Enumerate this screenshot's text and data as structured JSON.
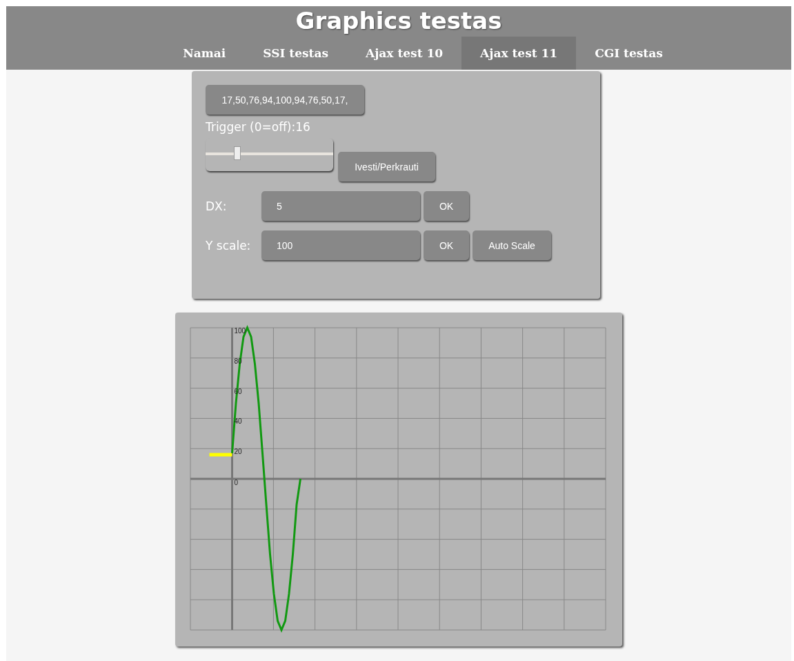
{
  "header": {
    "title": "Graphics testas"
  },
  "nav": [
    {
      "label": "Namai",
      "selected": false
    },
    {
      "label": "SSI testas",
      "selected": false
    },
    {
      "label": "Ajax test 10",
      "selected": false
    },
    {
      "label": "Ajax test 11",
      "selected": true
    },
    {
      "label": "CGI testas",
      "selected": false
    }
  ],
  "controls": {
    "data_button": "17,50,76,94,100,94,76,50,17,",
    "trigger_label": "Trigger (0=off):16",
    "trigger_slider": {
      "level": 0.25
    },
    "reload_button": "Ivesti/Perkrauti",
    "dx": {
      "label": "DX:",
      "value": "5",
      "ok": "OK"
    },
    "yscale": {
      "label": "Y scale:",
      "value": "100",
      "ok": "OK",
      "auto": "Auto Scale"
    }
  },
  "scope": {
    "y_labels": [
      "100",
      "80",
      "60",
      "40",
      "20",
      "0"
    ]
  }
}
